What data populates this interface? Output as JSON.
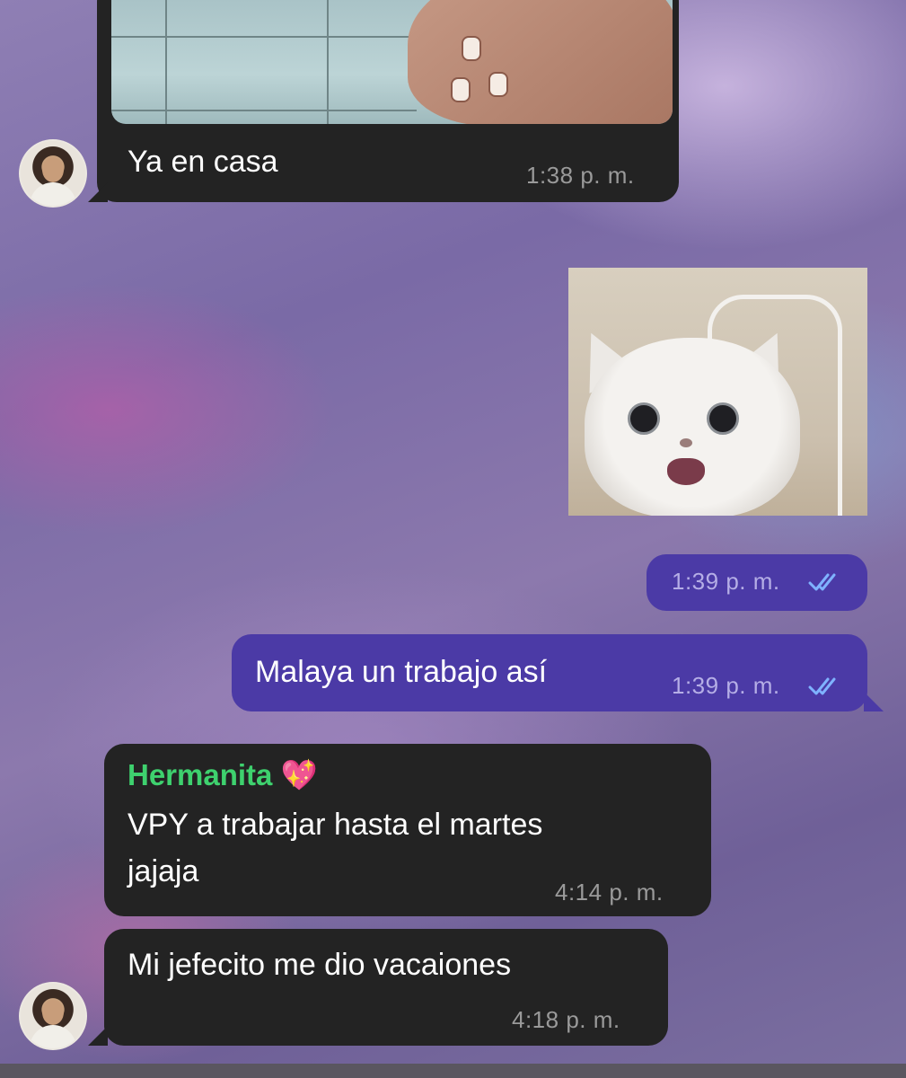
{
  "messages": [
    {
      "id": "m1",
      "direction": "incoming",
      "text": "Ya en casa",
      "time": "1:38 p. m."
    },
    {
      "id": "m2",
      "direction": "outgoing",
      "type": "image",
      "time": "1:39 p. m.",
      "status": "read"
    },
    {
      "id": "m3",
      "direction": "outgoing",
      "text": "Malaya un trabajo así",
      "time": "1:39 p. m.",
      "status": "read"
    },
    {
      "id": "m4",
      "direction": "incoming",
      "reply_to": "Hermanita 💖",
      "text": "VPY a trabajar hasta el martes\njajaja",
      "time": "4:14 p. m."
    },
    {
      "id": "m5",
      "direction": "incoming",
      "text": "Mi jefecito me dio vacaiones",
      "time": "4:18 p. m."
    }
  ],
  "colors": {
    "incoming_bubble": "#232323",
    "outgoing_bubble": "#4b3aa6",
    "sender_name": "#3ed16e",
    "read_ticks": "#7fb2ff"
  },
  "icons": {
    "read_status": "double-check-icon",
    "heart": "sparkling-heart-icon"
  }
}
